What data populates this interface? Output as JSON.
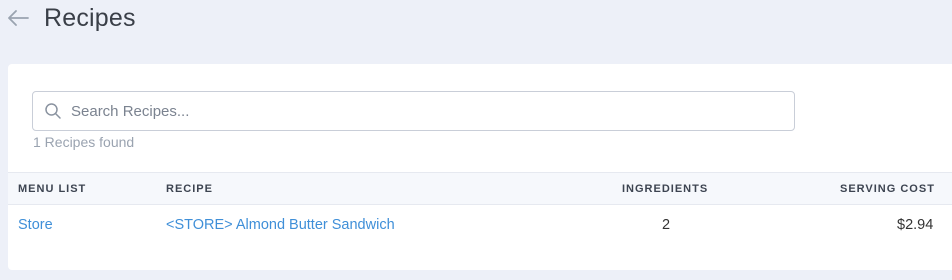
{
  "header": {
    "title": "Recipes"
  },
  "search": {
    "placeholder": "Search Recipes...",
    "value": "",
    "result_count": "1 Recipes found"
  },
  "table": {
    "columns": [
      "MENU LIST",
      "RECIPE",
      "INGREDIENTS",
      "SERVING COST"
    ],
    "rows": [
      {
        "menu_list": "Store",
        "recipe": "<STORE> Almond Butter Sandwich",
        "ingredients": "2",
        "serving_cost": "$2.94"
      }
    ]
  },
  "colors": {
    "link": "#3f8fd8",
    "page_bg": "#edf0f8",
    "card_bg": "#ffffff"
  },
  "icons": {
    "back": "arrow-left-icon",
    "search": "search-icon"
  }
}
